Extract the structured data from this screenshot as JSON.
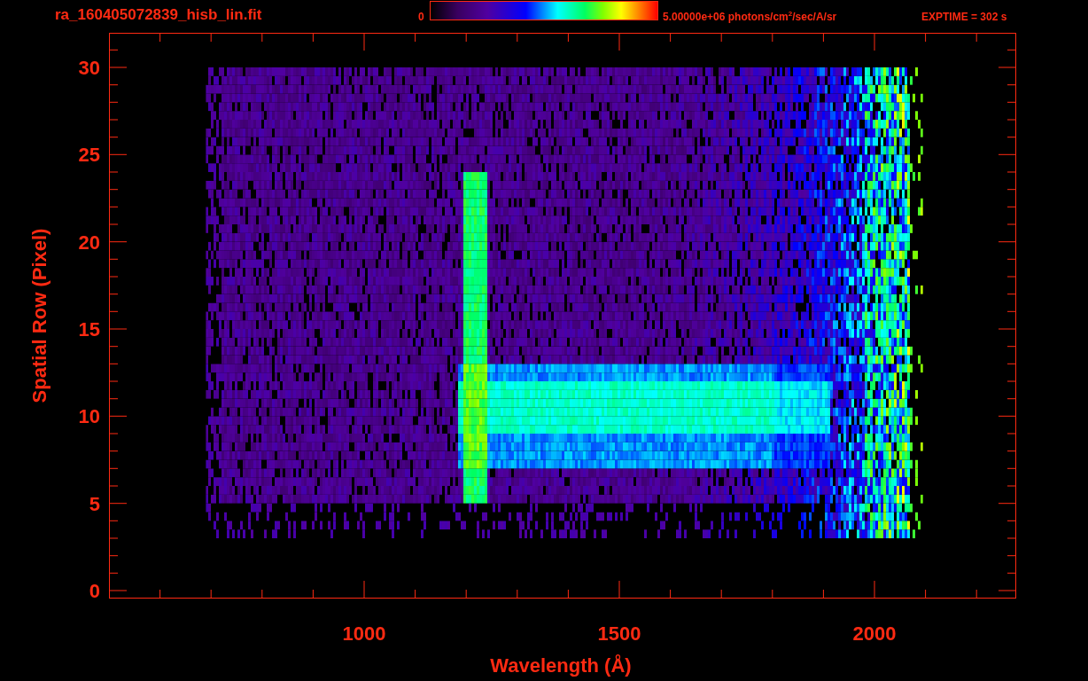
{
  "title": "ra_160405072839_hisb_lin.fit",
  "colorbar": {
    "min_label": "0",
    "max_label": "5.00000e+06 photons/cm$^{2}$/sec/A/sr"
  },
  "exposure": "EXPTIME = 302 s",
  "plot": {
    "xlabel": "Wavelength (Å)",
    "ylabel": "Spatial Row (Pixel)",
    "xticks": [
      "1000",
      "1500",
      "2000"
    ],
    "yticks": [
      "30",
      "25",
      "20",
      "15",
      "10",
      "5",
      "0"
    ]
  }
}
